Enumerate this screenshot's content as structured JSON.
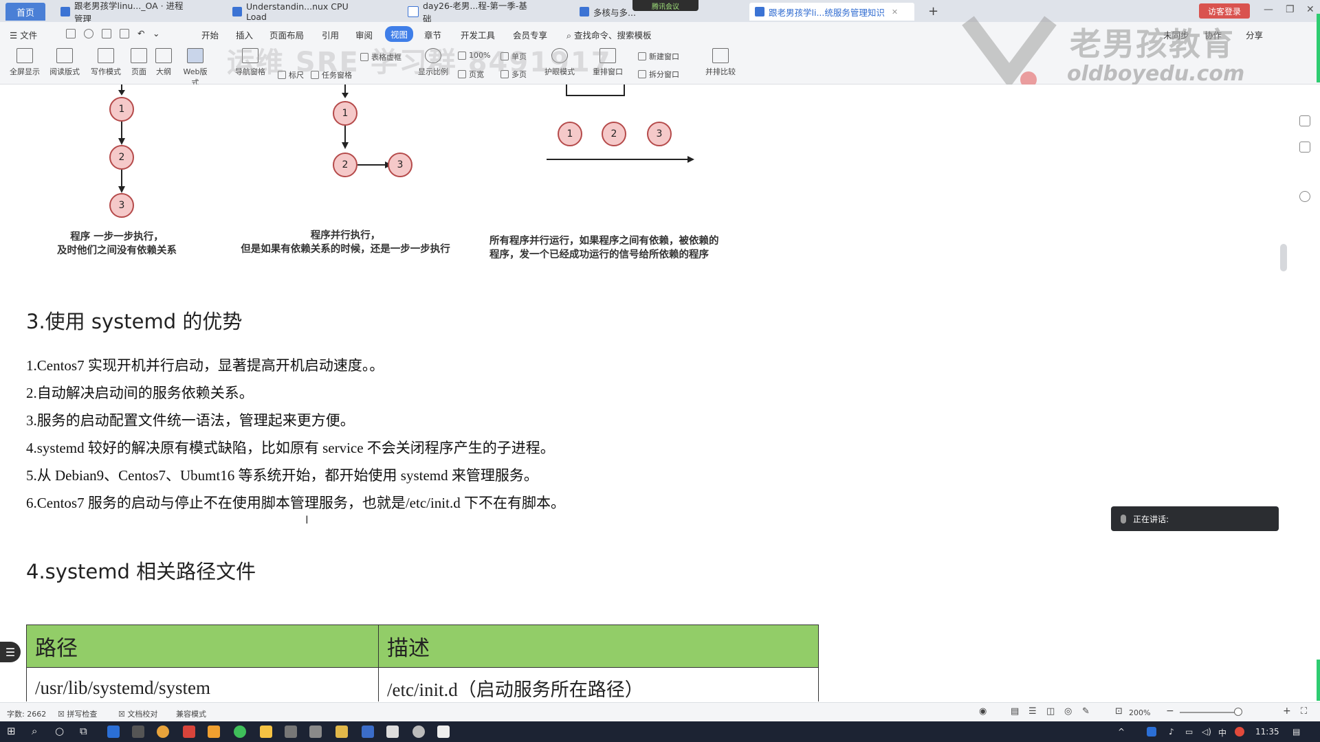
{
  "titlebar": {
    "home_tab": "首页",
    "tabs": [
      {
        "label": "跟老男孩学linu..._OA · 进程管理"
      },
      {
        "label": "Understandin...nux CPU Load"
      },
      {
        "label": "day26-老男...程-第一季-基础"
      },
      {
        "label": "多核与多..."
      },
      {
        "label": "跟老男孩学li...统服务管理知识"
      }
    ],
    "meeting_indicator": "腾讯会议",
    "login_button": "访客登录",
    "window_controls": [
      "—",
      "❐",
      "✕"
    ]
  },
  "menubar": {
    "file_label": "文件",
    "items": [
      "开始",
      "插入",
      "页面布局",
      "引用",
      "审阅",
      "视图",
      "章节",
      "开发工具",
      "会员专享"
    ],
    "active_item": "视图",
    "search_label": "查找命令、搜索模板",
    "right_items": [
      "未同步",
      "协作",
      "分享"
    ]
  },
  "ribbon": {
    "buttons": [
      "全屏显示",
      "阅读版式",
      "写作模式",
      "页面",
      "大纲",
      "Web版式",
      "导航窗格"
    ],
    "checks": [
      "标尺",
      "任务窗格",
      "表格虚框"
    ],
    "zoom_group": [
      "显示比例",
      "100%",
      "单页",
      "页宽",
      "多页"
    ],
    "more_buttons": [
      "护眼模式",
      "重排窗口",
      "新建窗口",
      "拆分窗口",
      "并排比较"
    ]
  },
  "watermark": {
    "brand": "老男孩教育",
    "url": "oldboyedu.com",
    "ghost_text": "运维 SRE 学习群 8491917"
  },
  "diagrams": [
    {
      "nodes": [
        "1",
        "2",
        "3"
      ],
      "caption_line1": "程序 一步一步执行，",
      "caption_line2": "及时他们之间没有依赖关系"
    },
    {
      "nodes": [
        "1",
        "2",
        "3"
      ],
      "caption_line1": "程序并行执行，",
      "caption_line2": "但是如果有依赖关系的时候，还是一步一步执行"
    },
    {
      "nodes": [
        "1",
        "2",
        "3"
      ],
      "caption_line1": "所有程序并行运行，如果程序之间有依赖，被依赖的",
      "caption_line2": "程序，发一个已经成功运行的信号给所依赖的程序"
    }
  ],
  "section3": {
    "heading": "3.使用 systemd 的优势",
    "items": [
      "1.Centos7 实现开机并行启动，显著提高开机启动速度。。",
      "2.自动解决启动间的服务依赖关系。",
      "3.服务的启动配置文件统一语法，管理起来更方便。",
      "4.systemd 较好的解决原有模式缺陷，比如原有 service 不会关闭程序产生的子进程。",
      "5.从 Debian9、Centos7、Ubumt16 等系统开始，都开始使用 systemd 来管理服务。",
      "6.Centos7 服务的启动与停止不在使用脚本管理服务，也就是/etc/init.d 下不在有脚本。"
    ]
  },
  "section4": {
    "heading": "4.systemd 相关路径文件",
    "table": {
      "headers": [
        "路径",
        "描述"
      ],
      "rows": [
        [
          "/usr/lib/systemd/system",
          "/etc/init.d（启动服务所在路径）"
        ]
      ]
    }
  },
  "speaking_popup": "正在讲话:",
  "statusbar": {
    "word_count": "字数: 2662",
    "spell_check": "拼写检查",
    "doc_check": "文档校对",
    "compat_mode": "兼容模式",
    "zoom": "200%"
  },
  "taskbar": {
    "time": "11:35",
    "ime": "中"
  },
  "colors": {
    "accent": "#3f7ee8",
    "table_header": "#92cd68",
    "node_fill": "#f5c9c9",
    "node_stroke": "#b54a4a",
    "login_red": "#d9534f"
  }
}
